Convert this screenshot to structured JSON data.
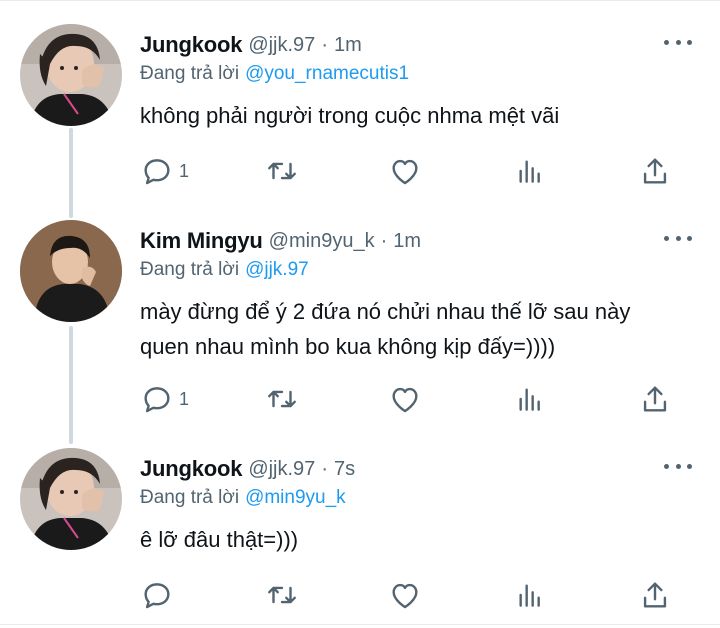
{
  "colors": {
    "text": "#0f1419",
    "secondary": "#536471",
    "link": "#1d9bf0",
    "thread_line": "#cfd9de"
  },
  "tweets": [
    {
      "name": "Jungkook",
      "handle": "@jjk.97",
      "separator": "·",
      "time": "1m",
      "reply_prefix": "Đang trả lời",
      "reply_to": "@you_rnamecutis1",
      "text_lines": [
        "không phải người trong cuộc nhma mệt vãi"
      ],
      "reply_count": "1",
      "avatar": "jungkook-avatar"
    },
    {
      "name": "Kim Mingyu",
      "handle": "@min9yu_k",
      "separator": "·",
      "time": "1m",
      "reply_prefix": "Đang trả lời",
      "reply_to": "@jjk.97",
      "text_lines": [
        "mày đừng để ý 2 đứa nó chửi nhau thế lỡ sau này",
        "quen nhau mình bo kua không kịp đấy=))))"
      ],
      "reply_count": "1",
      "avatar": "mingyu-avatar"
    },
    {
      "name": "Jungkook",
      "handle": "@jjk.97",
      "separator": "·",
      "time": "7s",
      "reply_prefix": "Đang trả lời",
      "reply_to": "@min9yu_k",
      "text_lines": [
        "ê lỡ đâu thật=)))"
      ],
      "reply_count": "",
      "avatar": "jungkook-avatar"
    }
  ],
  "icons": {
    "reply": "reply-icon",
    "retweet": "retweet-icon",
    "like": "heart-icon",
    "views": "analytics-icon",
    "share": "share-icon",
    "more": "more-icon"
  }
}
